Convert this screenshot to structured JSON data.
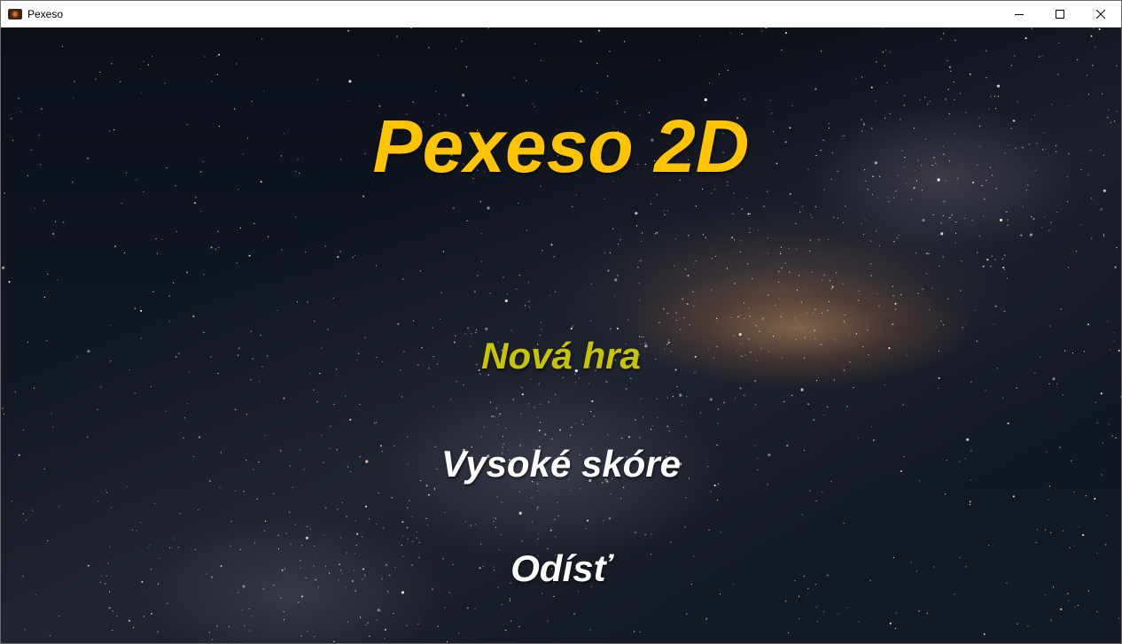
{
  "window": {
    "title": "Pexeso",
    "app_icon": "pexeso-app-icon",
    "controls": {
      "minimize_icon": "minimize-icon",
      "maximize_icon": "maximize-icon",
      "close_icon": "close-icon"
    }
  },
  "game": {
    "title": "Pexeso 2D",
    "background": "starry-night-milky-way",
    "menu": {
      "items": [
        {
          "label": "Nová hra",
          "state": "highlighted",
          "color": "#c9c400"
        },
        {
          "label": "Vysoké skóre",
          "state": "normal",
          "color": "#ffffff"
        },
        {
          "label": "Odísť",
          "state": "normal",
          "color": "#ffffff"
        }
      ]
    }
  },
  "colors": {
    "title": "#ffc400",
    "highlight": "#c9c400",
    "menu_text": "#ffffff",
    "titlebar_bg": "#ffffff"
  }
}
